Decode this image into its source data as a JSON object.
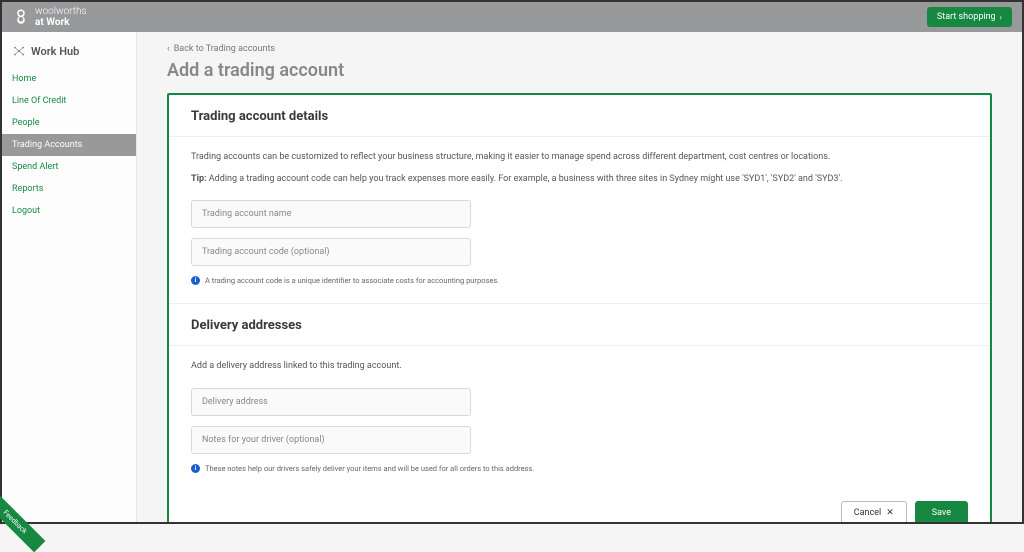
{
  "header": {
    "brand_line1": "woolworths",
    "brand_line2": "at Work",
    "start_shopping": "Start shopping"
  },
  "sidebar": {
    "title": "Work Hub",
    "items": [
      {
        "label": "Home",
        "active": false
      },
      {
        "label": "Line Of Credit",
        "active": false
      },
      {
        "label": "People",
        "active": false
      },
      {
        "label": "Trading Accounts",
        "active": true
      },
      {
        "label": "Spend Alert",
        "active": false
      },
      {
        "label": "Reports",
        "active": false
      },
      {
        "label": "Logout",
        "active": false
      }
    ]
  },
  "main": {
    "back_label": "Back to Trading accounts",
    "page_title": "Add a trading account",
    "section1": {
      "heading": "Trading account details",
      "help": "Trading accounts can be customized to reflect your business structure, making it easier to manage spend across different department, cost centres or locations.",
      "tip_prefix": "Tip:",
      "tip_body": " Adding a trading account code can help you track expenses more easily. For example, a business with three sites in Sydney might use 'SYD1', 'SYD2' and 'SYD3'.",
      "input_name_placeholder": "Trading account name",
      "input_code_placeholder": "Trading account code (optional)",
      "hint": "A trading account code is a unique identifier to associate costs for accounting purposes."
    },
    "section2": {
      "heading": "Delivery addresses",
      "help": "Add a delivery address linked to this trading account.",
      "input_address_placeholder": "Delivery address",
      "input_notes_placeholder": "Notes for your driver (optional)",
      "hint": "These notes help our drivers safely deliver your items and will be used for all orders to this address."
    },
    "actions": {
      "cancel": "Cancel",
      "save": "Save"
    }
  },
  "feedback": "Feedback"
}
